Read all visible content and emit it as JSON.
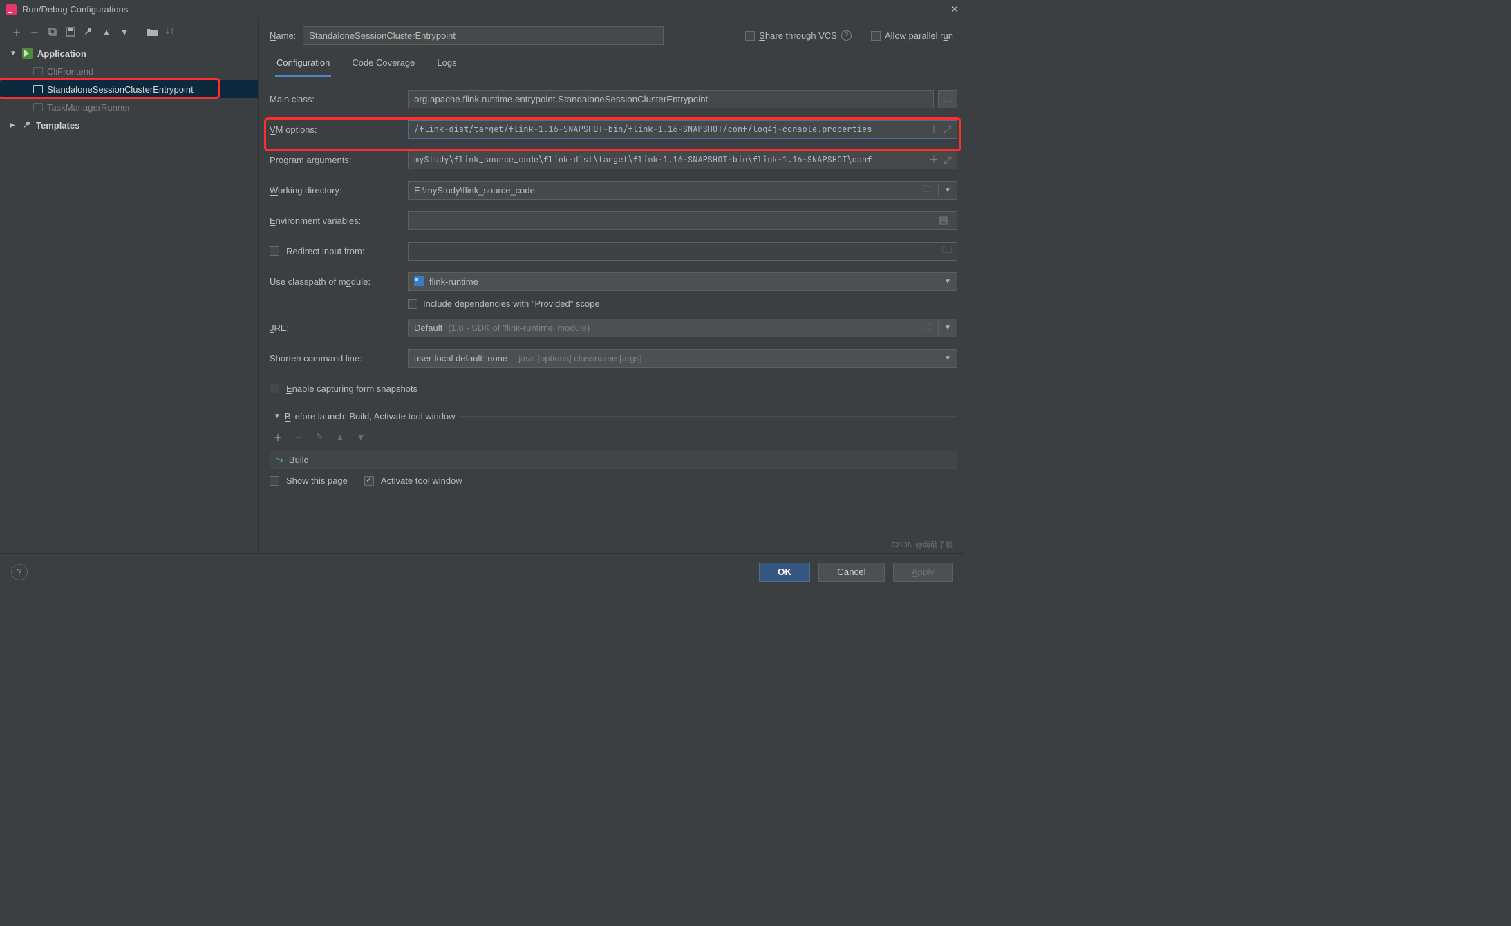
{
  "window": {
    "title": "Run/Debug Configurations"
  },
  "toolbar_icons": [
    "add",
    "remove",
    "copy",
    "save",
    "wrench",
    "up",
    "down",
    "folder",
    "sort"
  ],
  "tree": {
    "application_label": "Application",
    "items": [
      {
        "id": "cli",
        "label": "CliFrontend"
      },
      {
        "id": "sess",
        "label": "StandaloneSessionClusterEntrypoint"
      },
      {
        "id": "tm",
        "label": "TaskManagerRunner"
      }
    ],
    "templates_label": "Templates"
  },
  "header": {
    "name_label": "Name:",
    "name_value": "StandaloneSessionClusterEntrypoint",
    "share_label": "Share through VCS",
    "parallel_label": "Allow parallel run"
  },
  "tabs": {
    "configuration": "Configuration",
    "coverage": "Code Coverage",
    "logs": "Logs"
  },
  "form": {
    "main_class_label": "Main class:",
    "main_class_value": "org.apache.flink.runtime.entrypoint.StandaloneSessionClusterEntrypoint",
    "vm_label": "VM options:",
    "vm_value": "/flink-dist/target/flink-1.16-SNAPSHOT-bin/flink-1.16-SNAPSHOT/conf/log4j-console.properties",
    "args_label": "Program arguments:",
    "args_value": "myStudy\\flink_source_code\\flink-dist\\target\\flink-1.16-SNAPSHOT-bin\\flink-1.16-SNAPSHOT\\conf",
    "wd_label": "Working directory:",
    "wd_value": "E:\\myStudy\\flink_source_code",
    "env_label": "Environment variables:",
    "env_value": "",
    "redirect_label": "Redirect input from:",
    "module_label": "Use classpath of module:",
    "module_value": "flink-runtime",
    "include_provided": "Include dependencies with \"Provided\" scope",
    "jre_label": "JRE:",
    "jre_value": "Default",
    "jre_hint": "(1.8 - SDK of 'flink-runtime' module)",
    "shorten_label": "Shorten command line:",
    "shorten_value": "user-local default: none",
    "shorten_hint": "- java [options] classname [args]",
    "enable_forms": "Enable capturing form snapshots"
  },
  "before_launch": {
    "title": "Before launch: Build, Activate tool window",
    "item": "Build",
    "show_page": "Show this page",
    "activate": "Activate tool window"
  },
  "footer": {
    "ok": "OK",
    "cancel": "Cancel",
    "apply": "Apply"
  },
  "watermark": "CSDN @萌萌子桃"
}
